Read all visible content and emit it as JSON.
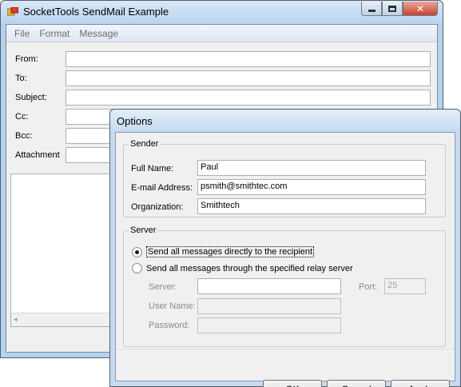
{
  "main_window": {
    "title": "SocketTools SendMail Example",
    "menu": [
      "File",
      "Format",
      "Message"
    ],
    "labels": {
      "from": "From:",
      "to": "To:",
      "subject": "Subject:",
      "cc": "Cc:",
      "bcc": "Bcc:",
      "attachment": "Attachment"
    },
    "values": {
      "from": "",
      "to": "",
      "subject": "",
      "cc": "",
      "bcc": "",
      "attachment": "",
      "body": ""
    },
    "scroll_left": "◂"
  },
  "options_dialog": {
    "title": "Options",
    "sender": {
      "legend": "Sender",
      "full_name_label": "Full Name:",
      "full_name": "Paul",
      "email_label": "E-mail Address:",
      "email": "psmith@smithtec.com",
      "org_label": "Organization:",
      "organization": "Smithtech"
    },
    "server": {
      "legend": "Server",
      "radio_direct": "Send all messages directly to the recipient",
      "radio_relay": "Send all messages through the specified relay server",
      "selected": "direct",
      "server_label": "Server:",
      "server_value": "",
      "port_label": "Port:",
      "port_value": "25",
      "username_label": "User Name:",
      "username_value": "",
      "password_label": "Password:",
      "password_value": ""
    },
    "buttons": {
      "ok": "OK",
      "cancel": "Cancel",
      "apply": "Apply"
    }
  }
}
